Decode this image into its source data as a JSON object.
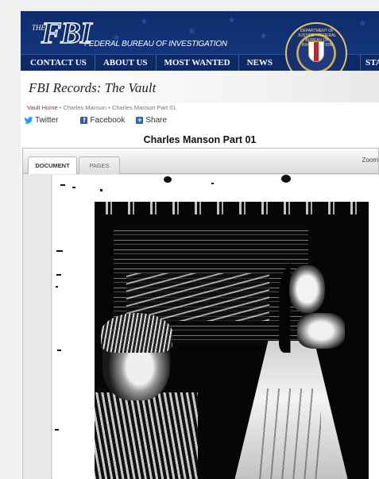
{
  "header": {
    "logo_the": "THE",
    "logo_fbi": "FBI",
    "logo_subtitle": "FEDERAL BUREAU OF INVESTIGATION",
    "seal_text": "DEPARTMENT OF JUSTICE • FEDERAL BUREAU OF INVESTIGATION"
  },
  "nav": {
    "items": [
      "CONTACT US",
      "ABOUT US",
      "MOST WANTED",
      "NEWS",
      "STATS"
    ]
  },
  "page": {
    "title": "FBI Records: The Vault"
  },
  "breadcrumb": {
    "home": "Vault Home",
    "sep1": " • ",
    "level1": "Charles Manson",
    "sep2": " • ",
    "current": "Charles Manson Part 01"
  },
  "share": {
    "twitter": "Twitter",
    "facebook": "Facebook",
    "share": "Share"
  },
  "document": {
    "title": "Charles Manson Part 01",
    "tabs": [
      "DOCUMENT",
      "PAGES"
    ],
    "active_tab": "DOCUMENT",
    "zoom_label": "Zoom"
  },
  "colors": {
    "header_blue": "#0e2c6c",
    "nav_blue": "#0d2a66",
    "breadcrumb_link": "#9a2f2f",
    "facebook": "#3b5998",
    "twitter": "#1da1f2"
  }
}
